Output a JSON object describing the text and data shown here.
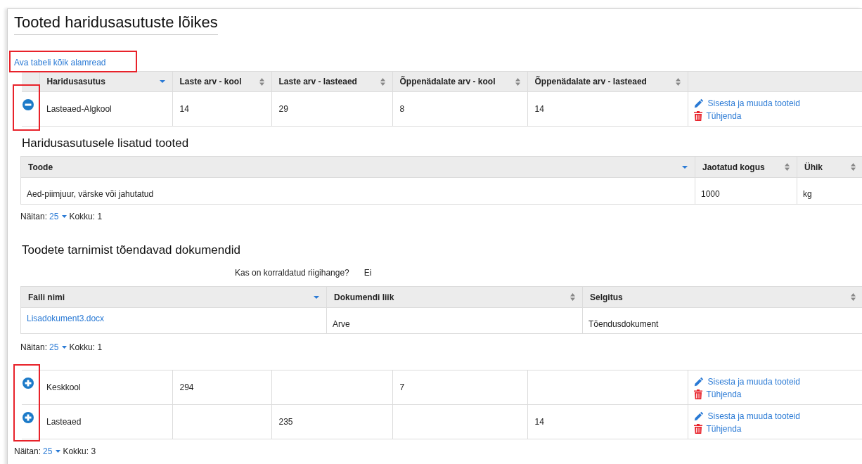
{
  "page_title": "Tooted haridusasutuste lõikes",
  "expand_all_link": "Ava tabeli kõik alamread",
  "table": {
    "columns": [
      {
        "label": "Haridusasutus",
        "sorted": true
      },
      {
        "label": "Laste arv - kool",
        "sorted": false
      },
      {
        "label": "Laste arv - lasteaed",
        "sorted": false
      },
      {
        "label": "Õppenädalate arv - kool",
        "sorted": false
      },
      {
        "label": "Õppenädalate arv - lasteaed",
        "sorted": false
      }
    ],
    "rows": [
      {
        "cells": [
          "Lasteaed-Algkool",
          "14",
          "29",
          "8",
          "14"
        ],
        "expanded": true,
        "actions": [
          {
            "kind": "edit",
            "label": "Sisesta ja muuda tooteid"
          },
          {
            "kind": "delete",
            "label": "Tühjenda"
          }
        ],
        "details": {
          "products": {
            "title": "Haridusasutusele lisatud tooted",
            "columns": [
              {
                "label": "Toode",
                "sorted": true
              },
              {
                "label": "Jaotatud kogus",
                "sorted": false
              },
              {
                "label": "Ühik",
                "sorted": false
              }
            ],
            "rows": [
              [
                "Aed-piimjuur, värske või jahutatud",
                "1000",
                "kg"
              ]
            ],
            "pager": {
              "label": "Näitan:",
              "page_size": "25",
              "total": "Kokku: 1"
            }
          },
          "documents": {
            "title": "Toodete tarnimist tõendavad dokumendid",
            "question": "Kas on korraldatud riigihange?",
            "answer": "Ei",
            "columns": [
              {
                "label": "Faili nimi",
                "sorted": true
              },
              {
                "label": "Dokumendi liik",
                "sorted": false
              },
              {
                "label": "Selgitus",
                "sorted": false
              }
            ],
            "rows": [
              {
                "file": "Lisadokument3.docx",
                "type": "Arve",
                "description": "Tõendusdokument"
              }
            ],
            "pager": {
              "label": "Näitan:",
              "page_size": "25",
              "total": "Kokku: 1"
            }
          }
        }
      },
      {
        "cells": [
          "Keskkool",
          "294",
          null,
          "7",
          null
        ],
        "expanded": false,
        "actions": [
          {
            "kind": "edit",
            "label": "Sisesta ja muuda tooteid"
          },
          {
            "kind": "delete",
            "label": "Tühjenda"
          }
        ]
      },
      {
        "cells": [
          "Lasteaed",
          null,
          "235",
          null,
          "14"
        ],
        "expanded": false,
        "actions": [
          {
            "kind": "edit",
            "label": "Sisesta ja muuda tooteid"
          },
          {
            "kind": "delete",
            "label": "Tühjenda"
          }
        ]
      }
    ],
    "pager": {
      "label": "Näitan:",
      "page_size": "25",
      "total": "Kokku: 3"
    }
  }
}
